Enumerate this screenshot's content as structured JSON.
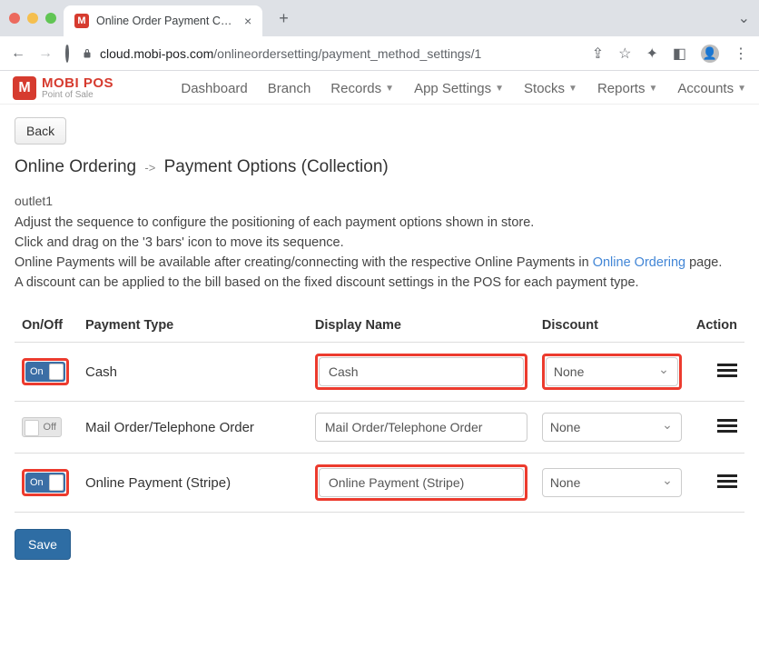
{
  "browser": {
    "tab_title": "Online Order Payment Configu",
    "url_host": "cloud.mobi-pos.com",
    "url_path": "/onlineordersetting/payment_method_settings/1"
  },
  "brand": {
    "name": "MOBI POS",
    "tagline": "Point of Sale",
    "glyph": "M"
  },
  "nav": {
    "items": [
      {
        "label": "Dashboard",
        "dropdown": false
      },
      {
        "label": "Branch",
        "dropdown": false
      },
      {
        "label": "Records",
        "dropdown": true
      },
      {
        "label": "App Settings",
        "dropdown": true
      },
      {
        "label": "Stocks",
        "dropdown": true
      },
      {
        "label": "Reports",
        "dropdown": true
      },
      {
        "label": "Accounts",
        "dropdown": true
      }
    ]
  },
  "page": {
    "back_label": "Back",
    "crumb1": "Online Ordering",
    "crumb_sep": "->",
    "crumb2": "Payment Options (Collection)",
    "outlet": "outlet1",
    "p1": "Adjust the sequence to configure the positioning of each payment options shown in store.",
    "p2": "Click and drag on the '3 bars' icon to move its sequence.",
    "p3a": "Online Payments will be available after creating/connecting with the respective Online Payments in ",
    "p3_link": "Online Ordering",
    "p3b": " page.",
    "p4": "A discount can be applied to the bill based on the fixed discount settings in the POS for each payment type.",
    "save_label": "Save"
  },
  "table": {
    "headers": {
      "onoff": "On/Off",
      "type": "Payment Type",
      "name": "Display Name",
      "discount": "Discount",
      "action": "Action"
    },
    "rows": [
      {
        "state": "On",
        "state_on": true,
        "type": "Cash",
        "display": "Cash",
        "discount": "None",
        "hl_toggle": true,
        "hl_display": true,
        "hl_discount": true
      },
      {
        "state": "Off",
        "state_on": false,
        "type": "Mail Order/Telephone Order",
        "display": "Mail Order/Telephone Order",
        "discount": "None",
        "hl_toggle": false,
        "hl_display": false,
        "hl_discount": false
      },
      {
        "state": "On",
        "state_on": true,
        "type": "Online Payment (Stripe)",
        "display": "Online Payment (Stripe)",
        "discount": "None",
        "hl_toggle": true,
        "hl_display": true,
        "hl_discount": false
      }
    ]
  }
}
